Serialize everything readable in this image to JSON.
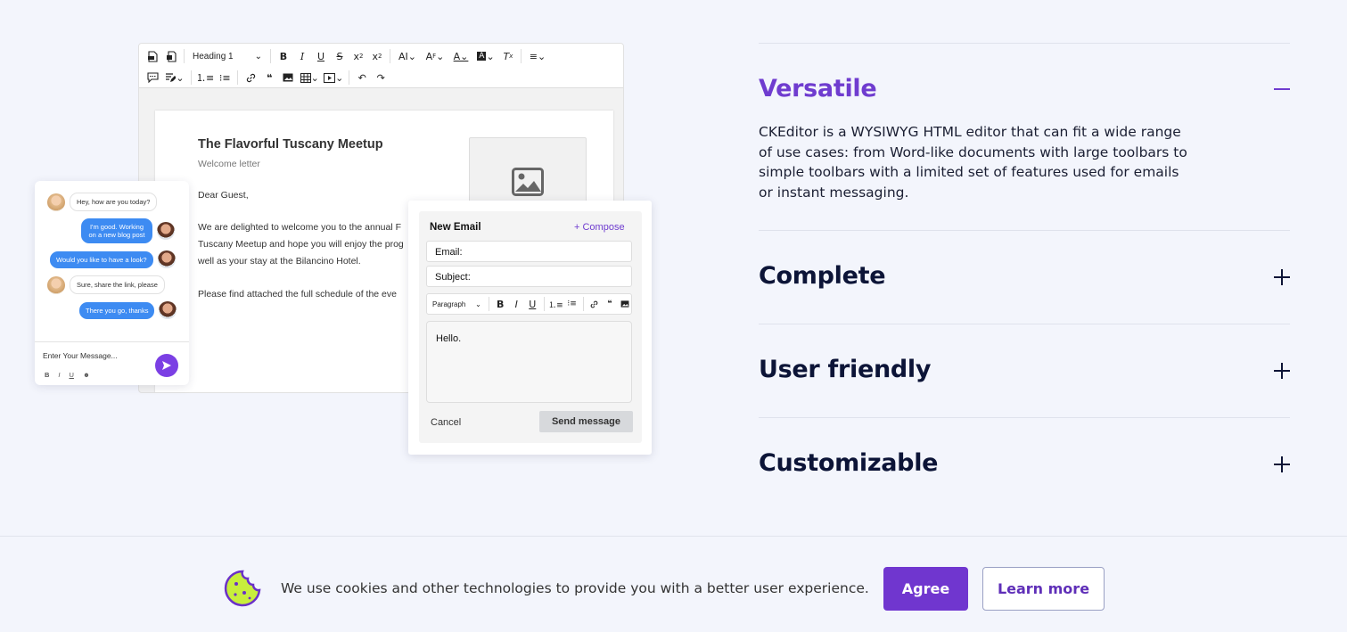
{
  "editor": {
    "toolbar": {
      "heading_select": "Heading 1",
      "row1_icons": [
        "export-pdf-icon",
        "export-word-icon",
        "heading-select",
        "bold-icon",
        "italic-icon",
        "underline-icon",
        "strikethrough-icon",
        "subscript-icon",
        "superscript-icon",
        "font-size-icon",
        "font-family-icon",
        "font-color-icon",
        "font-background-icon",
        "remove-format-icon",
        "align-icon"
      ],
      "row2_icons": [
        "comment-icon",
        "track-changes-icon",
        "numbered-list-icon",
        "bulleted-list-icon",
        "link-icon",
        "blockquote-icon",
        "image-icon",
        "table-icon",
        "media-icon",
        "undo-icon",
        "redo-icon"
      ]
    },
    "document": {
      "title": "The Flavorful Tuscany Meetup",
      "subtitle": "Welcome letter",
      "greeting": "Dear Guest,",
      "para1_line1": "We are delighted to welcome you to the annual F",
      "para1_line2": "Tuscany Meetup and hope you will enjoy the prog",
      "para1_line3": "well as your stay at the Bilancino Hotel.",
      "para2": "Please find attached the full schedule of the eve"
    }
  },
  "chat": {
    "messages": [
      {
        "side": "in",
        "text": "Hey, how are you today?"
      },
      {
        "side": "out",
        "text": "I'm good. Working on a new blog post"
      },
      {
        "side": "out",
        "text": "Would you like to have a look?"
      },
      {
        "side": "in",
        "text": "Sure, share the link, please"
      },
      {
        "side": "out",
        "text": "There you go, thanks"
      }
    ],
    "input_placeholder": "Enter Your Message...",
    "format": {
      "bold": "B",
      "italic": "I",
      "underline": "U"
    }
  },
  "email": {
    "title": "New Email",
    "compose": "+ Compose",
    "email_field": "Email:",
    "subject_field": "Subject:",
    "paragraph_select": "Paragraph",
    "body": "Hello.",
    "cancel": "Cancel",
    "send": "Send message"
  },
  "accordion": {
    "accent_color": "#6f3ccf",
    "items": [
      {
        "title": "Versatile",
        "expanded": true,
        "icon": "minus-icon",
        "body": "CKEditor is a WYSIWYG HTML editor that can fit a wide range of use cases: from Word-like documents with large toolbars to simple toolbars with a limited set of features used for emails or instant messaging."
      },
      {
        "title": "Complete",
        "expanded": false,
        "icon": "plus-icon"
      },
      {
        "title": "User friendly",
        "expanded": false,
        "icon": "plus-icon"
      },
      {
        "title": "Customizable",
        "expanded": false,
        "icon": "plus-icon"
      }
    ]
  },
  "cookie": {
    "text": "We use cookies and other technologies to provide you with a better user experience.",
    "agree": "Agree",
    "learn_more": "Learn more",
    "agree_color": "#7036cf"
  }
}
